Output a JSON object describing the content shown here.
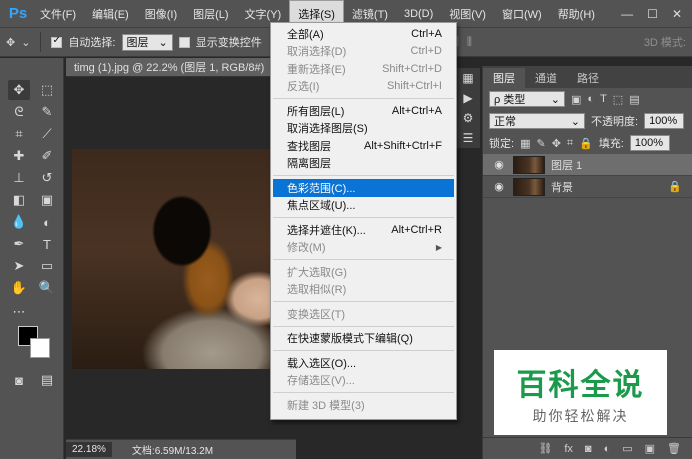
{
  "app": {
    "logo": "Ps"
  },
  "menubar": {
    "items": [
      "文件(F)",
      "编辑(E)",
      "图像(I)",
      "图层(L)",
      "文字(Y)",
      "选择(S)",
      "滤镜(T)",
      "3D(D)",
      "视图(V)",
      "窗口(W)",
      "帮助(H)"
    ],
    "active": "选择(S)"
  },
  "options": {
    "auto_select_label": "自动选择:",
    "auto_select_value": "图层",
    "show_transform_label": "显示变换控件",
    "mode3d_label": "3D 模式:"
  },
  "document": {
    "tab_title": "timg (1).jpg @ 22.2% (图层 1, RGB/8#)",
    "close": "×",
    "zoom": "22.18%",
    "doc_size": "文档:6.59M/13.2M"
  },
  "select_menu": {
    "groups": [
      [
        {
          "label": "全部(A)",
          "shortcut": "Ctrl+A",
          "disabled": false
        },
        {
          "label": "取消选择(D)",
          "shortcut": "Ctrl+D",
          "disabled": true
        },
        {
          "label": "重新选择(E)",
          "shortcut": "Shift+Ctrl+D",
          "disabled": true
        },
        {
          "label": "反选(I)",
          "shortcut": "Shift+Ctrl+I",
          "disabled": true
        }
      ],
      [
        {
          "label": "所有图层(L)",
          "shortcut": "Alt+Ctrl+A",
          "disabled": false
        },
        {
          "label": "取消选择图层(S)",
          "shortcut": "",
          "disabled": false
        },
        {
          "label": "查找图层",
          "shortcut": "Alt+Shift+Ctrl+F",
          "disabled": false
        },
        {
          "label": "隔离图层",
          "shortcut": "",
          "disabled": false
        }
      ],
      [
        {
          "label": "色彩范围(C)...",
          "shortcut": "",
          "disabled": false,
          "highlight": true
        },
        {
          "label": "焦点区域(U)...",
          "shortcut": "",
          "disabled": false
        }
      ],
      [
        {
          "label": "选择并遮住(K)...",
          "shortcut": "Alt+Ctrl+R",
          "disabled": false
        },
        {
          "label": "修改(M)",
          "shortcut": "",
          "disabled": true,
          "submenu": true
        }
      ],
      [
        {
          "label": "扩大选取(G)",
          "shortcut": "",
          "disabled": true
        },
        {
          "label": "选取相似(R)",
          "shortcut": "",
          "disabled": true
        }
      ],
      [
        {
          "label": "变换选区(T)",
          "shortcut": "",
          "disabled": true
        }
      ],
      [
        {
          "label": "在快速蒙版模式下编辑(Q)",
          "shortcut": "",
          "disabled": false
        }
      ],
      [
        {
          "label": "载入选区(O)...",
          "shortcut": "",
          "disabled": false
        },
        {
          "label": "存储选区(V)...",
          "shortcut": "",
          "disabled": true
        }
      ],
      [
        {
          "label": "新建 3D 模型(3)",
          "shortcut": "",
          "disabled": true
        }
      ]
    ]
  },
  "layers_panel": {
    "tabs": [
      "图层",
      "通道",
      "路径"
    ],
    "active_tab": "图层",
    "filter_label": "ρ 类型",
    "blend_mode": "正常",
    "opacity_label": "不透明度:",
    "opacity_value": "100%",
    "lock_label": "锁定:",
    "fill_label": "填充:",
    "fill_value": "100%",
    "layers": [
      {
        "name": "图层 1",
        "selected": true,
        "locked": false
      },
      {
        "name": "背景",
        "selected": false,
        "locked": true
      }
    ]
  },
  "watermark": {
    "title": "百科全说",
    "subtitle": "助你轻松解决"
  }
}
